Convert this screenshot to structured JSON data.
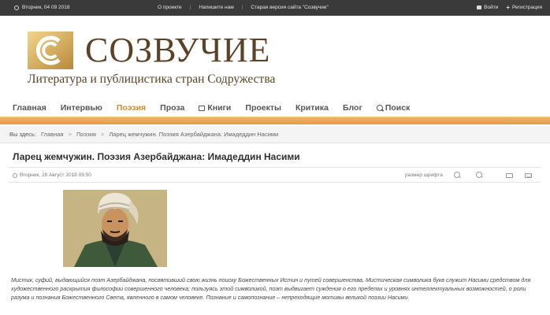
{
  "topbar": {
    "date": "Вторник, 04 09 2018",
    "links": [
      "О проекте",
      "Напишите нам",
      "Старая версия сайта \"Созвучие\""
    ],
    "login": "Войти",
    "register": "Регистрация"
  },
  "header": {
    "logo_text": "СОЗВУЧИЕ",
    "subtitle": "Литература и публицистика стран Содружества"
  },
  "nav": {
    "items": [
      {
        "label": "Главная"
      },
      {
        "label": "Интервью"
      },
      {
        "label": "Поэзия",
        "active": true
      },
      {
        "label": "Проза"
      },
      {
        "label": "Книги",
        "icon": "book-icon"
      },
      {
        "label": "Проекты"
      },
      {
        "label": "Критика"
      },
      {
        "label": "Блог"
      },
      {
        "label": "Поиск",
        "icon": "search-icon"
      }
    ],
    "accent_color": "#d58a2e"
  },
  "breadcrumb": {
    "prefix": "Вы здесь:",
    "items": [
      "Главная",
      "Поэзия",
      "Ларец жемчужин. Поэзия Азербайджана: Имадеддин Насими"
    ]
  },
  "article": {
    "title": "Ларец жемчужин. Поэзия Азербайджана: Имадеддин Насими",
    "date": "Вторник, 28 Август 2018 09:50",
    "font_size_label": "размер шрифта",
    "intro": "Мистик, суфий, выдающийся поэт Азербайджана, посвятивший свою жизнь поиску Божественных Истин и путей совершенства. Мистическая символика букв служит Насими средством для художественного раскрытия философии совершенного человека; пользуясь этой символикой, поэт выдвигает суждения о его пределах и уровнях интеллектуальных возможностей, о роли разума и познания Божественного Света, явленного в самом человеке. Познание и самопознание – непреходящие мотивы великой поэзии Насими."
  }
}
